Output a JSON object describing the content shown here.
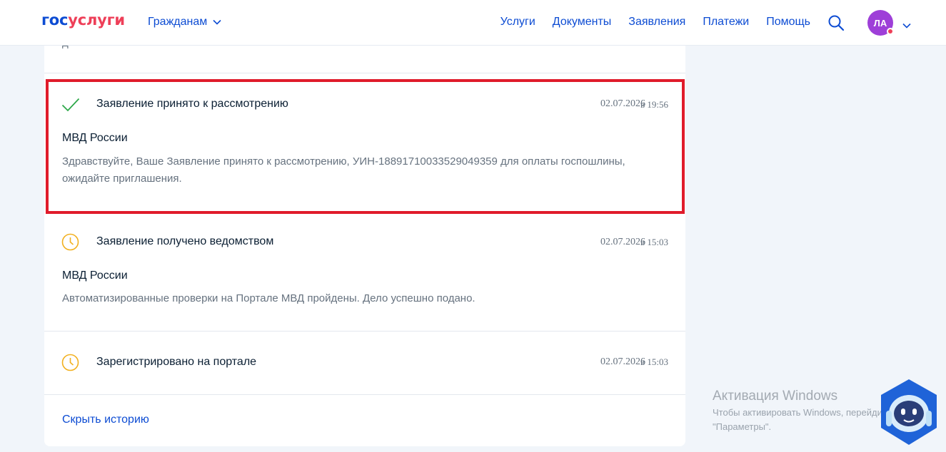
{
  "header": {
    "logo_part1": "гос",
    "logo_part2": "услуги",
    "citizens_label": "Гражданам",
    "nav": [
      "Услуги",
      "Документы",
      "Заявления",
      "Платежи",
      "Помощь"
    ],
    "avatar_initials": "ЛА"
  },
  "history": {
    "previous_text_fragment": "д",
    "entries": [
      {
        "status": "check",
        "title": "Заявление принято к рассмотрению",
        "date": "02.07.2026",
        "time": "в 19:56",
        "org": "МВД России",
        "text": "Здравствуйте, Ваше Заявление принято к рассмотрению, УИН-18891710033529049359 для оплаты госпошлины, ожидайте приглашения."
      },
      {
        "status": "clock",
        "title": "Заявление получено ведомством",
        "date": "02.07.2026",
        "time": "в 15:03",
        "org": "МВД России",
        "text": "Автоматизированные проверки на Портале МВД пройдены. Дело успешно подано."
      },
      {
        "status": "clock",
        "title": "Зарегистрировано на портале",
        "date": "02.07.2026",
        "time": "в 15:03"
      }
    ],
    "hide_label": "Скрыть историю"
  },
  "watermark": {
    "title": "Активация Windows",
    "subtitle": "Чтобы активировать Windows, перейдите в раздел \"Параметры\"."
  },
  "colors": {
    "brand_blue": "#0d4cd3",
    "brand_red": "#ee3f58",
    "success_green": "#2ea84a",
    "pending_yellow": "#f2b01e",
    "highlight_red": "#e01b2b"
  }
}
